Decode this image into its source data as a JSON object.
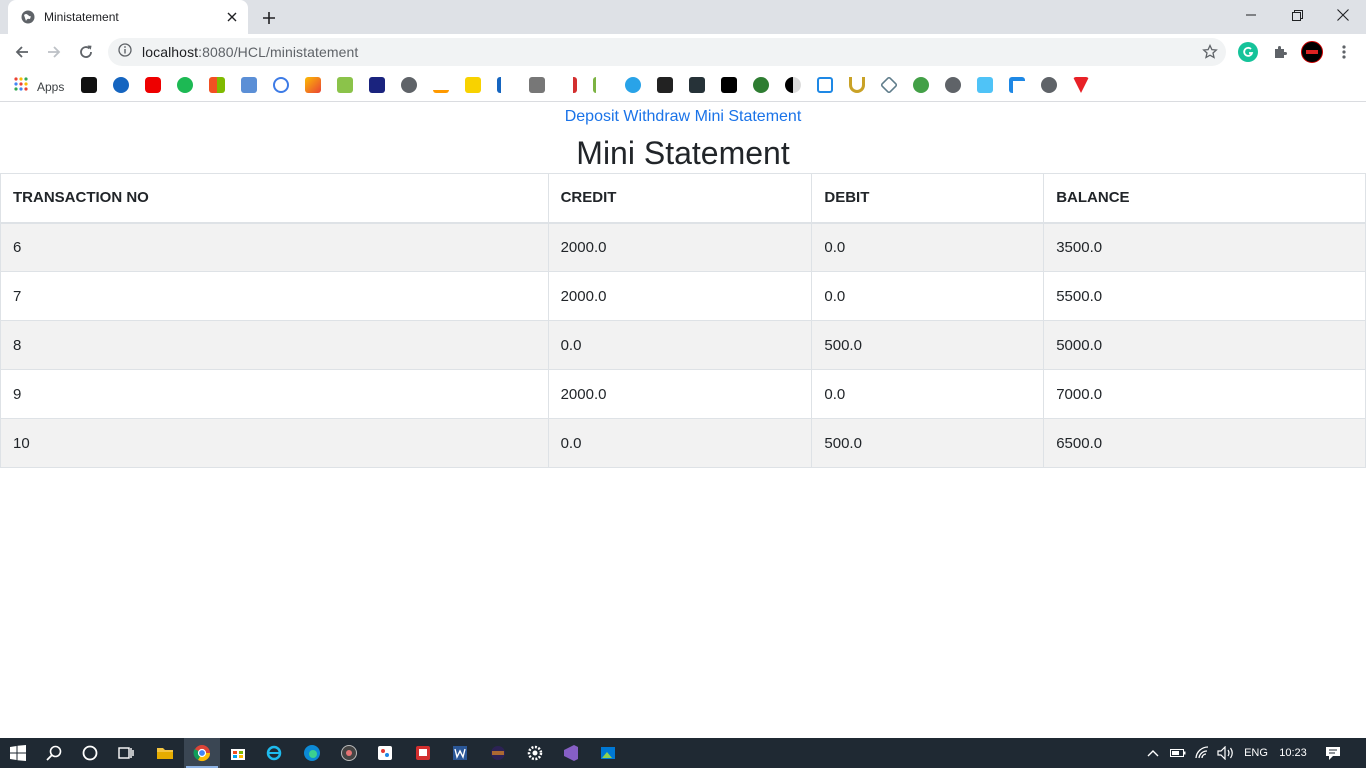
{
  "browser": {
    "tab_title": "Ministatement",
    "url_host": "localhost",
    "url_path": ":8080/HCL/ministatement",
    "bookmarks_apps_label": "Apps",
    "bookmark_icons": [
      "apps-grid-icon",
      "zodiac-icon",
      "play-blue-icon",
      "youtube-icon",
      "one-icon",
      "microsoft-icon",
      "tv-icon",
      "infinity-icon",
      "triangle-icon",
      "grid-icon",
      "star-dark-icon",
      "globe-icon",
      "amazon-icon",
      "flipkart-icon",
      "seven-icon",
      "vm-icon",
      "v-icon",
      "figure-icon",
      "play-icon",
      "sf-icon",
      "h-icon",
      "building-icon",
      "circle-green-icon",
      "yin-yang-icon",
      "window-icon",
      "horseshoe-icon",
      "diamond-icon",
      "b-green-icon",
      "globe-icon-2",
      "bird-icon",
      "f-blue-icon",
      "globe-icon-3",
      "tesla-icon"
    ]
  },
  "page": {
    "nav": {
      "deposit": "Deposit",
      "withdraw": "Withdraw",
      "mini_statement": "Mini Statement"
    },
    "title": "Mini Statement",
    "table": {
      "headers": [
        "TRANSACTION NO",
        "CREDIT",
        "DEBIT",
        "BALANCE"
      ],
      "rows": [
        [
          "6",
          "2000.0",
          "0.0",
          "3500.0"
        ],
        [
          "7",
          "2000.0",
          "0.0",
          "5500.0"
        ],
        [
          "8",
          "0.0",
          "500.0",
          "5000.0"
        ],
        [
          "9",
          "2000.0",
          "0.0",
          "7000.0"
        ],
        [
          "10",
          "0.0",
          "500.0",
          "6500.0"
        ]
      ]
    }
  },
  "taskbar": {
    "language": "ENG",
    "time": "10:23"
  },
  "colors": {
    "link": "#1a73e8",
    "striped_row": "#f2f2f2",
    "taskbar": "#1f2933"
  }
}
